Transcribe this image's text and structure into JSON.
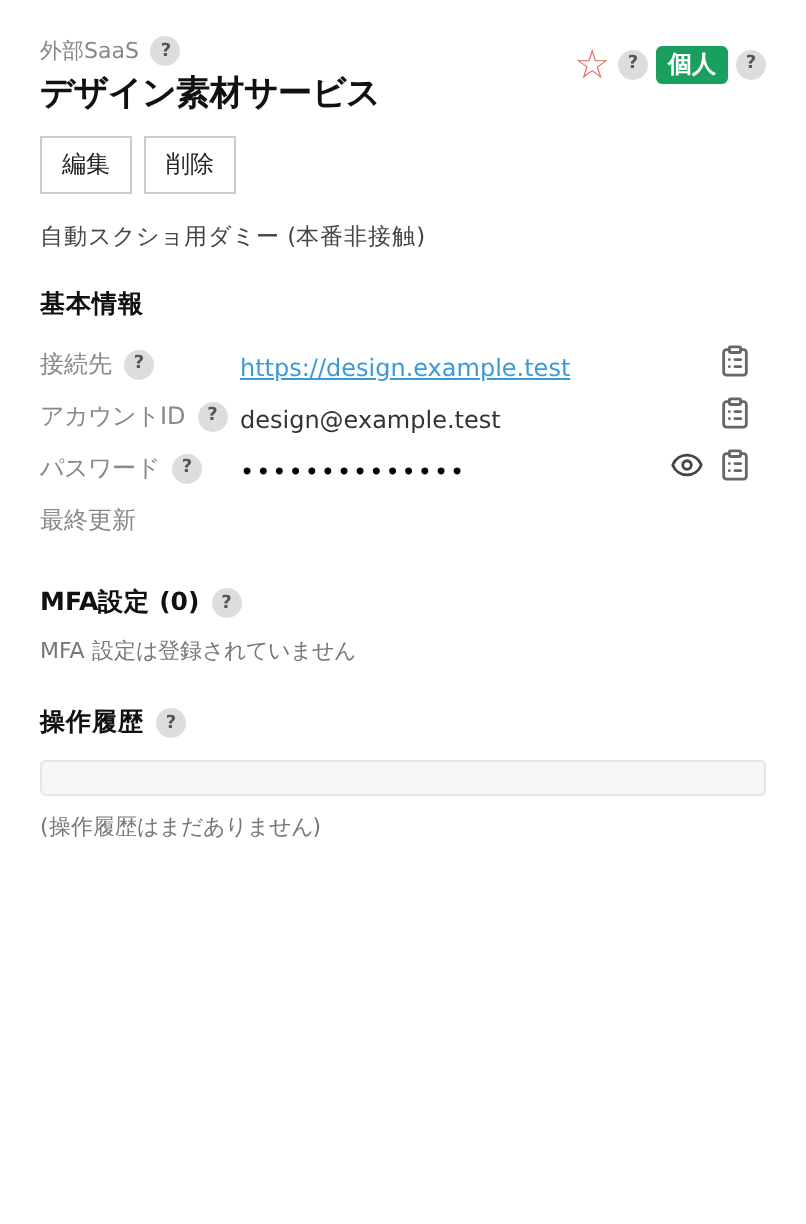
{
  "header": {
    "category": "外部SaaS",
    "category_help": "?",
    "title": "デザイン素材サービス",
    "star": "☆",
    "starred": false,
    "star_help": "?",
    "badge": "個人",
    "badge_help": "?"
  },
  "actions": [
    "編集",
    "削除"
  ],
  "note": "自動スクショ用ダミー (本番非接触)",
  "basic_info": {
    "heading": "基本情報",
    "fields": [
      {
        "kind": "link",
        "label": "接続先",
        "help": "?",
        "value": "https://design.example.test",
        "copyable": true,
        "revealable": false
      },
      {
        "kind": "text",
        "label": "アカウントID",
        "help": "?",
        "value": "design@example.test",
        "copyable": true,
        "revealable": false
      },
      {
        "kind": "secret",
        "label": "パスワード",
        "help": "?",
        "value": "••••••••••••••",
        "copyable": true,
        "revealable": true
      },
      {
        "kind": "text",
        "label": "最終更新",
        "copyable": false,
        "revealable": false
      }
    ]
  },
  "mfa": {
    "heading": "MFA設定 (0)",
    "help": "?",
    "empty": "MFA 設定は登録されていません"
  },
  "history": {
    "heading": "操作履歴",
    "help": "?",
    "empty": "(操作履歴はまだありません)"
  }
}
